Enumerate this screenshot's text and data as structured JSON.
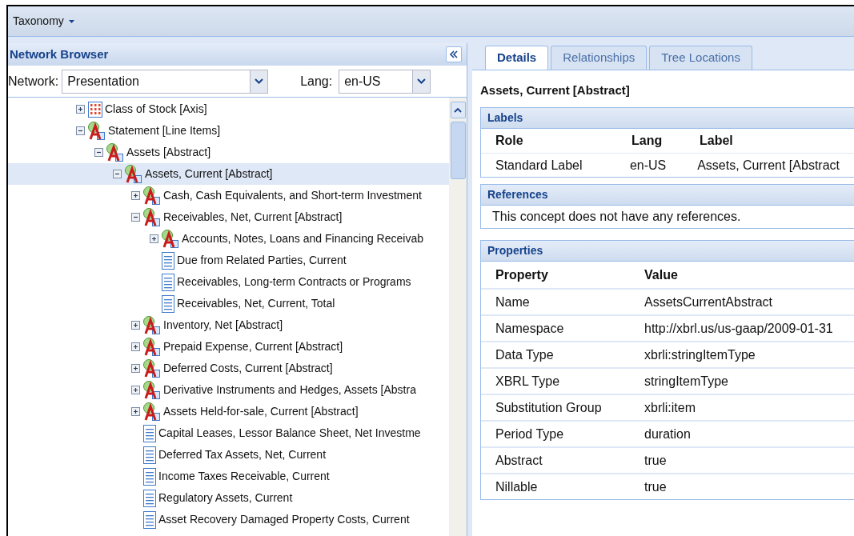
{
  "menu": {
    "label": "Taxonomy"
  },
  "network_browser": {
    "title": "Network Browser",
    "network_label": "Network:",
    "network_value": "Presentation",
    "lang_label": "Lang:",
    "lang_value": "en-US"
  },
  "tree": [
    {
      "label": "Class of Stock [Axis]",
      "kind": "axis",
      "expanded": false,
      "selected": false
    },
    {
      "label": "Statement [Line Items]",
      "kind": "abstract",
      "expanded": true,
      "selected": false,
      "children": [
        {
          "label": "Assets [Abstract]",
          "kind": "abstract",
          "expanded": true,
          "selected": false,
          "children": [
            {
              "label": "Assets, Current [Abstract]",
              "kind": "abstract",
              "expanded": true,
              "selected": true,
              "children": [
                {
                  "label": "Cash, Cash Equivalents, and Short-term Investment",
                  "kind": "abstract",
                  "expanded": false,
                  "selected": false
                },
                {
                  "label": "Receivables, Net, Current [Abstract]",
                  "kind": "abstract",
                  "expanded": true,
                  "selected": false,
                  "children": [
                    {
                      "label": "Accounts, Notes, Loans and Financing Receivab",
                      "kind": "abstract",
                      "expanded": false,
                      "selected": false
                    },
                    {
                      "label": "Due from Related Parties, Current",
                      "kind": "concept",
                      "selected": false
                    },
                    {
                      "label": "Receivables, Long-term Contracts or Programs",
                      "kind": "concept",
                      "selected": false
                    },
                    {
                      "label": "Receivables, Net, Current, Total",
                      "kind": "concept",
                      "selected": false
                    }
                  ]
                },
                {
                  "label": "Inventory, Net [Abstract]",
                  "kind": "abstract",
                  "expanded": false,
                  "selected": false
                },
                {
                  "label": "Prepaid Expense, Current [Abstract]",
                  "kind": "abstract",
                  "expanded": false,
                  "selected": false
                },
                {
                  "label": "Deferred Costs, Current [Abstract]",
                  "kind": "abstract",
                  "expanded": false,
                  "selected": false
                },
                {
                  "label": "Derivative Instruments and Hedges, Assets [Abstra",
                  "kind": "abstract",
                  "expanded": false,
                  "selected": false
                },
                {
                  "label": "Assets Held-for-sale, Current [Abstract]",
                  "kind": "abstract",
                  "expanded": false,
                  "selected": false
                },
                {
                  "label": "Capital Leases, Lessor Balance Sheet, Net Investme",
                  "kind": "concept",
                  "selected": false
                },
                {
                  "label": "Deferred Tax Assets, Net, Current",
                  "kind": "concept",
                  "selected": false
                },
                {
                  "label": "Income Taxes Receivable, Current",
                  "kind": "concept",
                  "selected": false
                },
                {
                  "label": "Regulatory Assets, Current",
                  "kind": "concept",
                  "selected": false
                },
                {
                  "label": "Asset Recovery Damaged Property Costs, Current",
                  "kind": "concept",
                  "selected": false
                }
              ]
            }
          ]
        }
      ]
    }
  ],
  "tabs": [
    {
      "label": "Details",
      "selected": true
    },
    {
      "label": "Relationships",
      "selected": false
    },
    {
      "label": "Tree Locations",
      "selected": false
    }
  ],
  "details": {
    "title": "Assets, Current [Abstract]",
    "labels": {
      "title": "Labels",
      "columns": [
        "Role",
        "Lang",
        "Label"
      ],
      "rows": [
        [
          "Standard Label",
          "en-US",
          "Assets, Current [Abstract"
        ]
      ]
    },
    "references": {
      "title": "References",
      "message": "This concept does not have any references."
    },
    "properties": {
      "title": "Properties",
      "columns": [
        "Property",
        "Value"
      ],
      "rows": [
        [
          "Name",
          "AssetsCurrentAbstract"
        ],
        [
          "Namespace",
          "http://xbrl.us/us-gaap/2009-01-31"
        ],
        [
          "Data Type",
          "xbrli:stringItemType"
        ],
        [
          "XBRL Type",
          "stringItemType"
        ],
        [
          "Substitution Group",
          "xbrli:item"
        ],
        [
          "Period Type",
          "duration"
        ],
        [
          "Abstract",
          "true"
        ],
        [
          "Nillable",
          "true"
        ]
      ]
    }
  }
}
